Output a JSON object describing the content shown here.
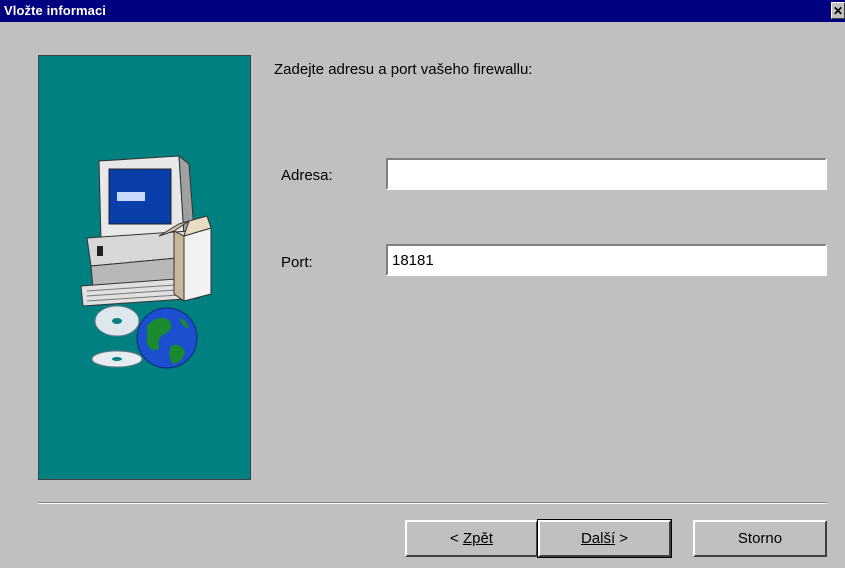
{
  "window": {
    "title": "Vložte informaci",
    "close_glyph": "✕"
  },
  "illustration": {
    "icons": [
      "computer-icon",
      "open-box-icon",
      "cd-icon",
      "globe-icon"
    ],
    "background": "#008080"
  },
  "form": {
    "heading": "Zadejte adresu a port vašeho firewallu:",
    "address_label": "Adresa:",
    "address_value": "",
    "port_label": "Port:",
    "port_value": "18181"
  },
  "buttons": {
    "back_prefix": "< ",
    "back_label": "Zpět",
    "next_label": "Další",
    "next_suffix": " >",
    "cancel_label": "Storno"
  }
}
